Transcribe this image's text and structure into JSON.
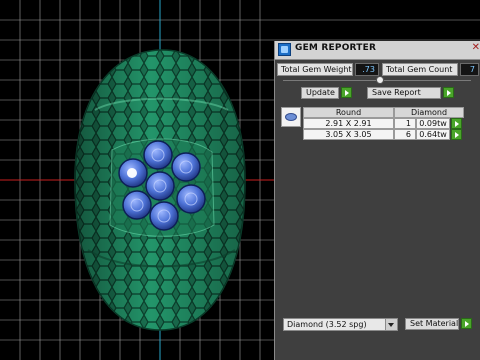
{
  "panel": {
    "title": "GEM REPORTER",
    "total_gem_weight_label": "Total Gem Weight",
    "total_gem_weight_value": ".73",
    "total_gem_count_label": "Total Gem Count",
    "total_gem_count_value": "7",
    "update_label": "Update",
    "save_report_label": "Save Report",
    "table": {
      "headers": [
        "Round",
        "Diamond"
      ],
      "rows": [
        {
          "size": "2.91 X 2.91",
          "count": "1",
          "weight": "0.09tw"
        },
        {
          "size": "3.05 X 3.05",
          "count": "6",
          "weight": "0.64tw"
        }
      ]
    },
    "material_select": "Diamond   (3.52 spg)",
    "set_material_label": "Set Material"
  },
  "colors": {
    "viewport_bg": "#000000",
    "grid": "#d8d8d8",
    "model_green": "#1f8a5e",
    "gem_blue": "#4f74d8",
    "accent_green": "#4aa52a",
    "value_text": "#7ec8ff"
  },
  "icons": [
    "app-icon",
    "close-icon",
    "arrow-right-icon",
    "chevron-down-icon",
    "gem-thumbnail"
  ]
}
